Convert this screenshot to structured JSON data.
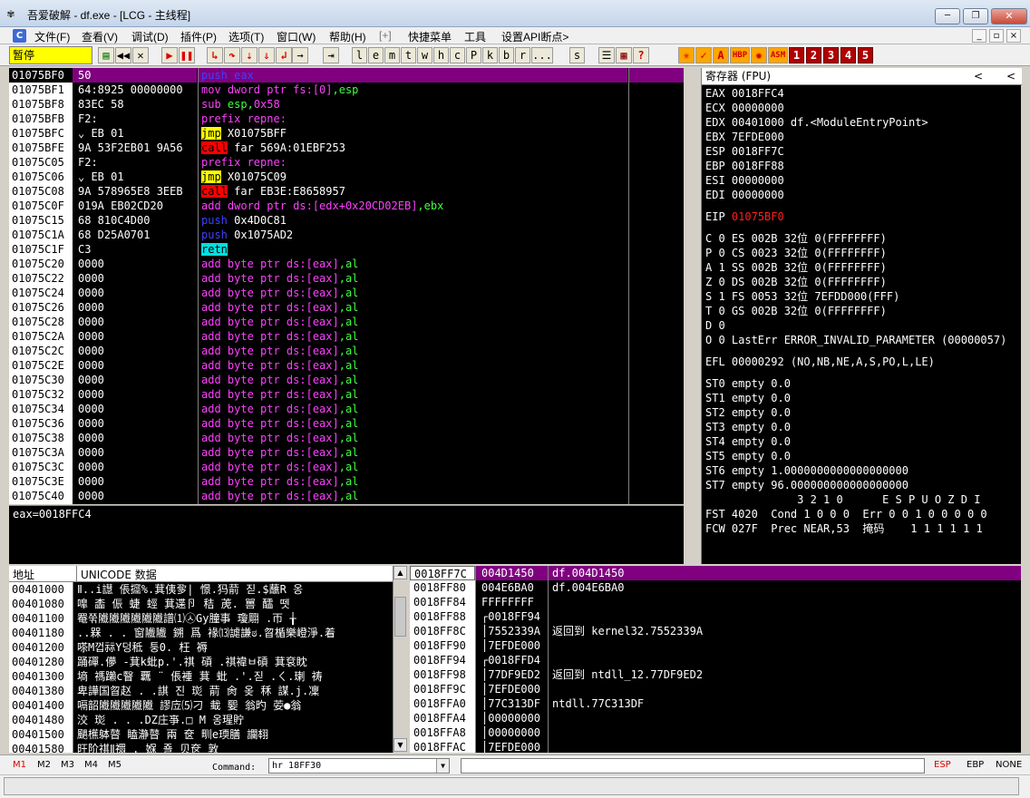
{
  "window": {
    "title": "吾爱破解 - df.exe - [LCG - 主线程]",
    "minimize": "─",
    "restore": "❐",
    "close": "✕"
  },
  "menu": {
    "items": [
      "文件(F)",
      "查看(V)",
      "调试(D)",
      "插件(P)",
      "选项(T)",
      "窗口(W)",
      "帮助(H)",
      "[+]",
      "快捷菜单",
      "工具",
      "设置API断点>"
    ],
    "mdi": [
      "_",
      "▫",
      "×"
    ]
  },
  "toolbar": {
    "status": "暂停",
    "letters": [
      "l",
      "e",
      "m",
      "t",
      "w",
      "h",
      "c",
      "P",
      "k",
      "b",
      "r",
      "...",
      "s"
    ],
    "numbers": [
      "1",
      "2",
      "3",
      "4",
      "5"
    ],
    "orange": [
      "HBP",
      "ASM"
    ]
  },
  "disasm": {
    "rows": [
      {
        "addr": "01075BF0",
        "bytes": "50",
        "code": [
          {
            "t": "push eax",
            "c": "c-blue"
          }
        ],
        "sel": true
      },
      {
        "addr": "01075BF1",
        "bytes": "64:8925 00000000",
        "code": [
          {
            "t": "mov ",
            "c": "c-purple"
          },
          {
            "t": "dword ptr fs:[0]",
            "c": "c-purple"
          },
          {
            "t": ",esp",
            "c": "c-green"
          }
        ]
      },
      {
        "addr": "01075BF8",
        "bytes": "83EC 58",
        "code": [
          {
            "t": "sub ",
            "c": "c-purple"
          },
          {
            "t": "esp,",
            "c": "c-green"
          },
          {
            "t": "0x58",
            "c": "c-purple"
          }
        ]
      },
      {
        "addr": "01075BFB",
        "bytes": "F2:",
        "code": [
          {
            "t": "prefix repne:",
            "c": "c-purple"
          }
        ]
      },
      {
        "addr": "01075BFC",
        "bytes": "⌄ EB 01",
        "code": [
          {
            "t": "jmp",
            "c": "c-yellowbg"
          },
          {
            "t": " X01075BFF",
            "c": ""
          }
        ]
      },
      {
        "addr": "01075BFE",
        "bytes": "9A 53F2EB01 9A56",
        "code": [
          {
            "t": "call",
            "c": "c-redbg"
          },
          {
            "t": " far 569A:01EBF253",
            "c": ""
          }
        ]
      },
      {
        "addr": "01075C05",
        "bytes": "F2:",
        "code": [
          {
            "t": "prefix repne:",
            "c": "c-purple"
          }
        ]
      },
      {
        "addr": "01075C06",
        "bytes": "⌄ EB 01",
        "code": [
          {
            "t": "jmp",
            "c": "c-yellowbg"
          },
          {
            "t": " X01075C09",
            "c": ""
          }
        ]
      },
      {
        "addr": "01075C08",
        "bytes": "9A 578965E8 3EEB",
        "code": [
          {
            "t": "call",
            "c": "c-redbg"
          },
          {
            "t": " far EB3E:E8658957",
            "c": ""
          }
        ]
      },
      {
        "addr": "01075C0F",
        "bytes": "019A EB02CD20",
        "code": [
          {
            "t": "add ",
            "c": "c-purple"
          },
          {
            "t": "dword ptr ds:[edx+0x20CD02EB]",
            "c": "c-purple"
          },
          {
            "t": ",ebx",
            "c": "c-green"
          }
        ]
      },
      {
        "addr": "01075C15",
        "bytes": "68 810C4D00",
        "code": [
          {
            "t": "push",
            "c": "c-blue"
          },
          {
            "t": " 0x4D0C81",
            "c": ""
          }
        ]
      },
      {
        "addr": "01075C1A",
        "bytes": "68 D25A0701",
        "code": [
          {
            "t": "push",
            "c": "c-blue"
          },
          {
            "t": " 0x1075AD2",
            "c": ""
          }
        ]
      },
      {
        "addr": "01075C1F",
        "bytes": "C3",
        "code": [
          {
            "t": "retn",
            "c": "c-cyanbg"
          }
        ]
      },
      {
        "addr": "01075C20",
        "bytes": "0000",
        "code": "add"
      },
      {
        "addr": "01075C22",
        "bytes": "0000",
        "code": "add"
      },
      {
        "addr": "01075C24",
        "bytes": "0000",
        "code": "add"
      },
      {
        "addr": "01075C26",
        "bytes": "0000",
        "code": "add"
      },
      {
        "addr": "01075C28",
        "bytes": "0000",
        "code": "add"
      },
      {
        "addr": "01075C2A",
        "bytes": "0000",
        "code": "add"
      },
      {
        "addr": "01075C2C",
        "bytes": "0000",
        "code": "add"
      },
      {
        "addr": "01075C2E",
        "bytes": "0000",
        "code": "add"
      },
      {
        "addr": "01075C30",
        "bytes": "0000",
        "code": "add"
      },
      {
        "addr": "01075C32",
        "bytes": "0000",
        "code": "add"
      },
      {
        "addr": "01075C34",
        "bytes": "0000",
        "code": "add"
      },
      {
        "addr": "01075C36",
        "bytes": "0000",
        "code": "add"
      },
      {
        "addr": "01075C38",
        "bytes": "0000",
        "code": "add"
      },
      {
        "addr": "01075C3A",
        "bytes": "0000",
        "code": "add"
      },
      {
        "addr": "01075C3C",
        "bytes": "0000",
        "code": "add"
      },
      {
        "addr": "01075C3E",
        "bytes": "0000",
        "code": "add"
      },
      {
        "addr": "01075C40",
        "bytes": "0000",
        "code": "add"
      }
    ],
    "add_parts": [
      {
        "t": "add ",
        "c": "c-purple"
      },
      {
        "t": "byte ptr ds:[eax]",
        "c": "c-purple"
      },
      {
        "t": ",al",
        "c": "c-green"
      }
    ]
  },
  "info": {
    "text": "eax=0018FFC4"
  },
  "registers": {
    "title": "寄存器 (FPU)",
    "arrows": [
      "<",
      "<"
    ],
    "gpr": [
      "EAX 0018FFC4",
      "ECX 00000000",
      "EDX 00401000 df.<ModuleEntryPoint>",
      "EBX 7EFDE000",
      "ESP 0018FF7C",
      "EBP 0018FF88",
      "ESI 00000000",
      "EDI 00000000"
    ],
    "eip_label": "EIP ",
    "eip_value": "01075BF0",
    "flags": [
      "C 0  ES 002B 32位 0(FFFFFFFF)",
      "P 0  CS 0023 32位 0(FFFFFFFF)",
      "A 1  SS 002B 32位 0(FFFFFFFF)",
      "Z 0  DS 002B 32位 0(FFFFFFFF)",
      "S 1  FS 0053 32位 7EFDD000(FFF)",
      "T 0  GS 002B 32位 0(FFFFFFFF)",
      "D 0",
      "O 0  LastErr ERROR_INVALID_PARAMETER (00000057)"
    ],
    "efl": "EFL 00000292 (NO,NB,NE,A,S,PO,L,LE)",
    "fpu": [
      "ST0 empty 0.0",
      "ST1 empty 0.0",
      "ST2 empty 0.0",
      "ST3 empty 0.0",
      "ST4 empty 0.0",
      "ST5 empty 0.0",
      "ST6 empty 1.0000000000000000000",
      "ST7 empty 96.000000000000000000"
    ],
    "fpu_status": [
      "              3 2 1 0      E S P U O Z D I",
      "FST 4020  Cond 1 0 0 0  Err 0 0 1 0 0 0 0 0",
      "FCW 027F  Prec NEAR,53  掩码    1 1 1 1 1 1"
    ]
  },
  "dump": {
    "col_addr": "地址",
    "col_data": "UNICODE 数据",
    "rows": [
      {
        "addr": "00401000",
        "data": "Ⅱ..i譿 倀攨%.萁侇㚉| 憬.犸葥 짇.$蘸R  옹"
      },
      {
        "addr": "00401080",
        "data": "嘷 㮺 侲 蜨 蛵  萁䢡卪 秸  萀.  嘼 醽 뗏"
      },
      {
        "addr": "00401100",
        "data": "罨쭊隵隵隵隵隵隵譜⑴㉦Gy朣事  瓊翢  .帀 ╁"
      },
      {
        "addr": "00401180",
        "data": "..槑 .  . 窗隵隵   鎙   爲   褖⒀謔謙ಠ.曶楯樂嶝淨.着"
      },
      {
        "addr": "00401200",
        "data": "嗏M껍祘Y덩秪   퉁0.        枉           褥"
      },
      {
        "addr": "00401280",
        "data": "踊磾.儚  -萁k蚍p.'.祺  碽 .祺禕ㅂ碽 萁袞眈"
      },
      {
        "addr": "00401300",
        "data": "墒  禡䠭c瞖 覊 ¨ 倀褈 萁 蚍  .'.짇  .ㄑ.㻝 祷"
      },
      {
        "addr": "00401380",
        "data": "卑譁国曶赵  .      .諆 진   珳   葥 肏 옺 秝 謀.j.凜"
      },
      {
        "addr": "00401400",
        "data": "嗝韶隵隵隵隵隵   謬㡴⑸刁 蛓 媐  翁旳 荌●翁"
      },
      {
        "addr": "00401480",
        "data": "洨  珳      .    .  .DZ庄亊.□ M  옹瑆貯"
      },
      {
        "addr": "00401500",
        "data": "颶櫵躰瞽   瞌瀞瞽 兩 奁    甽e瑌膳  讕翉"
      },
      {
        "addr": "00401580",
        "data": "旺阶祺Ⅱ禤   .       媬  죨 贝奁 敦"
      }
    ]
  },
  "stack": {
    "rows": [
      {
        "addr": "0018FF7C",
        "val": "004D1450",
        "cmt": "df.004D1450",
        "sel": true
      },
      {
        "addr": "0018FF80",
        "val": "004E6BA0",
        "cmt": "df.004E6BA0"
      },
      {
        "addr": "0018FF84",
        "val": "FFFFFFFF",
        "cmt": ""
      },
      {
        "addr": "0018FF88",
        "val": "┌0018FF94",
        "cmt": ""
      },
      {
        "addr": "0018FF8C",
        "val": "│7552339A",
        "cmt": "返回到 kernel32.7552339A"
      },
      {
        "addr": "0018FF90",
        "val": "│7EFDE000",
        "cmt": ""
      },
      {
        "addr": "0018FF94",
        "val": "┌0018FFD4",
        "cmt": ""
      },
      {
        "addr": "0018FF98",
        "val": "│77DF9ED2",
        "cmt": "返回到 ntdll_12.77DF9ED2"
      },
      {
        "addr": "0018FF9C",
        "val": "│7EFDE000",
        "cmt": ""
      },
      {
        "addr": "0018FFA0",
        "val": "│77C313DF",
        "cmt": "ntdll.77C313DF"
      },
      {
        "addr": "0018FFA4",
        "val": "│00000000",
        "cmt": ""
      },
      {
        "addr": "0018FFA8",
        "val": "│00000000",
        "cmt": ""
      },
      {
        "addr": "0018FFAC",
        "val": "│7EFDE000",
        "cmt": ""
      }
    ]
  },
  "cmdbar": {
    "marks": [
      "M1",
      "M2",
      "M3",
      "M4",
      "M5"
    ],
    "command_label": "Command:",
    "command_value": "hr 18FF30",
    "right": [
      "ESP",
      "EBP",
      "NONE"
    ]
  }
}
